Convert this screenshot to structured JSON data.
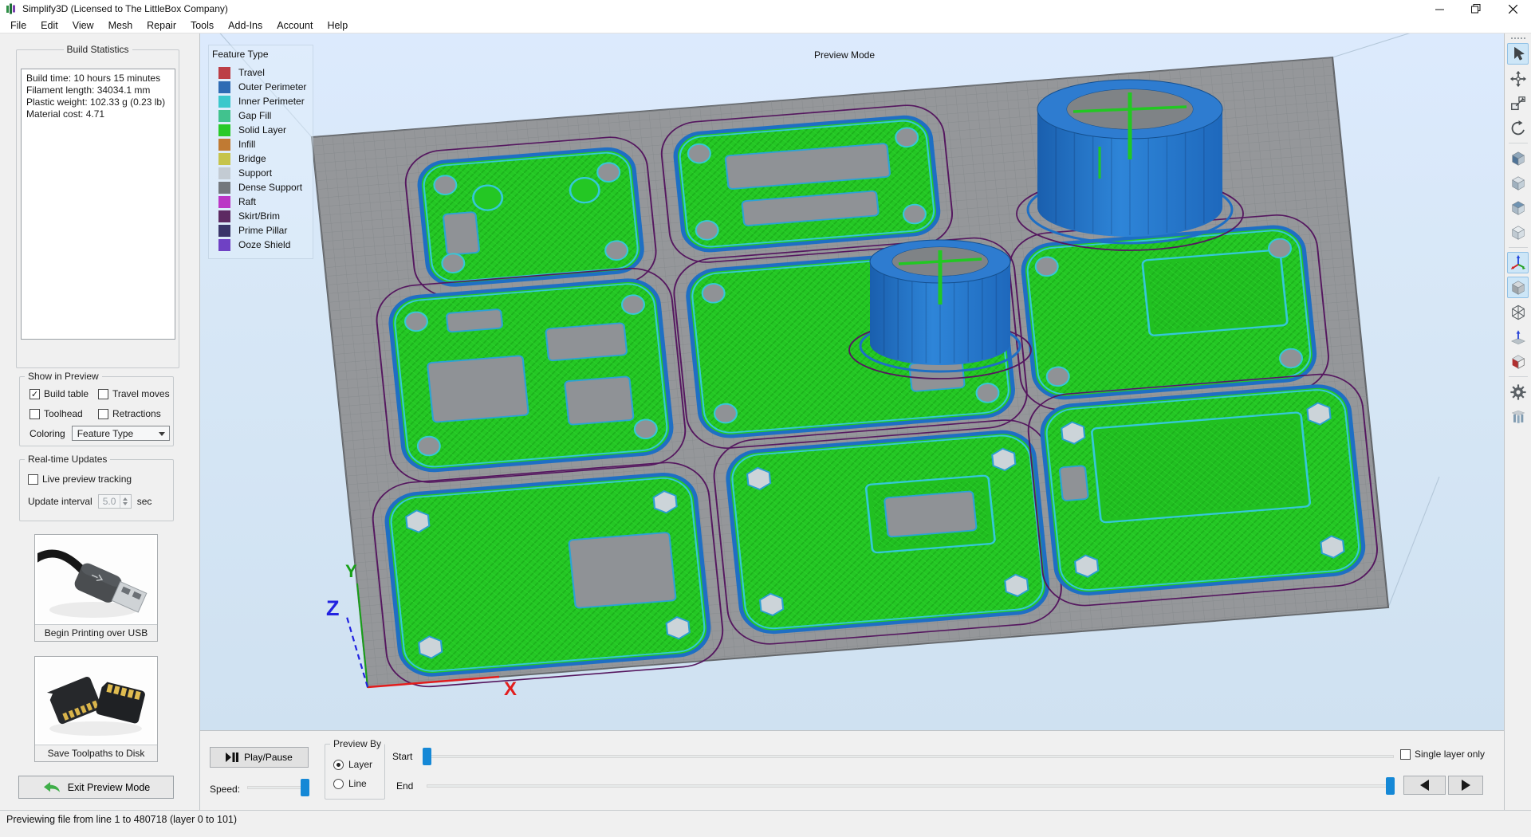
{
  "window": {
    "title": "Simplify3D (Licensed to The LittleBox Company)"
  },
  "menu": {
    "items": [
      "File",
      "Edit",
      "View",
      "Mesh",
      "Repair",
      "Tools",
      "Add-Ins",
      "Account",
      "Help"
    ]
  },
  "left_panel": {
    "build_statistics": {
      "title": "Build Statistics",
      "lines": [
        "Build time: 10 hours 15 minutes",
        "Filament length: 34034.1 mm",
        "Plastic weight: 102.33 g (0.23 lb)",
        "Material cost: 4.71"
      ]
    },
    "show_in_preview": {
      "title": "Show in Preview",
      "checkboxes": [
        {
          "label": "Build table",
          "checked": true
        },
        {
          "label": "Travel moves",
          "checked": false
        },
        {
          "label": "Toolhead",
          "checked": false
        },
        {
          "label": "Retractions",
          "checked": false
        }
      ],
      "coloring_label": "Coloring",
      "coloring_value": "Feature Type"
    },
    "realtime_updates": {
      "title": "Real-time Updates",
      "live_preview": {
        "label": "Live preview tracking",
        "checked": false
      },
      "update_interval_label": "Update interval",
      "update_interval_value": "5.0",
      "update_interval_unit": "sec"
    },
    "usb_button_label": "Begin Printing over USB",
    "sd_button_label": "Save Toolpaths to Disk",
    "exit_button_label": "Exit Preview Mode"
  },
  "viewport": {
    "mode_label": "Preview Mode",
    "legend": {
      "title": "Feature Type",
      "items": [
        {
          "label": "Travel",
          "color": "#bc3e46"
        },
        {
          "label": "Outer Perimeter",
          "color": "#2e6bb4"
        },
        {
          "label": "Inner Perimeter",
          "color": "#3bc8cc"
        },
        {
          "label": "Gap Fill",
          "color": "#41c28e"
        },
        {
          "label": "Solid Layer",
          "color": "#28ca28"
        },
        {
          "label": "Infill",
          "color": "#c07a33"
        },
        {
          "label": "Bridge",
          "color": "#c6c44c"
        },
        {
          "label": "Support",
          "color": "#c3cbd3"
        },
        {
          "label": "Dense Support",
          "color": "#73787d"
        },
        {
          "label": "Raft",
          "color": "#bb36c6"
        },
        {
          "label": "Skirt/Brim",
          "color": "#5d2a62"
        },
        {
          "label": "Prime Pillar",
          "color": "#3a3569"
        },
        {
          "label": "Ooze Shield",
          "color": "#6f41c4"
        }
      ]
    },
    "axes": {
      "x": "X",
      "y": "Y",
      "z": "Z"
    }
  },
  "right_toolbar": {
    "tools": [
      {
        "name": "select-tool",
        "selected": true
      },
      {
        "name": "move-tool",
        "selected": false
      },
      {
        "name": "scale-tool",
        "selected": false
      },
      {
        "name": "rotate-tool",
        "selected": false
      },
      {
        "name": "view-cube-1",
        "selected": false
      },
      {
        "name": "view-cube-2",
        "selected": false
      },
      {
        "name": "view-cube-3",
        "selected": false
      },
      {
        "name": "view-cube-4",
        "selected": false
      },
      {
        "name": "coordinate-axes-view",
        "selected": true
      },
      {
        "name": "solid-render-view",
        "selected": true
      },
      {
        "name": "wireframe-view",
        "selected": false
      },
      {
        "name": "surface-normals-view",
        "selected": false
      },
      {
        "name": "cross-section-view",
        "selected": false
      },
      {
        "name": "machine-settings",
        "selected": false
      },
      {
        "name": "support-structures",
        "selected": false
      }
    ]
  },
  "bottom_bar": {
    "play_pause_label": "Play/Pause",
    "speed_label": "Speed:",
    "preview_by": {
      "title": "Preview By",
      "options": [
        {
          "label": "Layer",
          "selected": true
        },
        {
          "label": "Line",
          "selected": false
        }
      ]
    },
    "start_label": "Start",
    "end_label": "End",
    "single_layer": {
      "label": "Single layer only",
      "checked": false
    }
  },
  "status_bar": {
    "text": "Previewing file from line 1 to 480718 (layer 0 to 101)"
  }
}
